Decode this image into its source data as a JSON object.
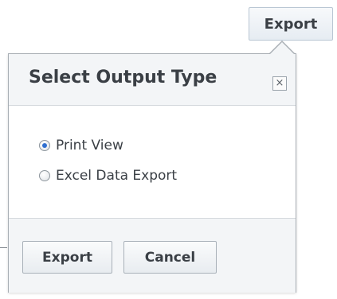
{
  "toolbar": {
    "export_label": "Export"
  },
  "dialog": {
    "title": "Select Output Type",
    "close_glyph": "×",
    "options": [
      {
        "label": "Print View",
        "checked": true
      },
      {
        "label": "Excel Data Export",
        "checked": false
      }
    ],
    "export_label": "Export",
    "cancel_label": "Cancel"
  },
  "colors": {
    "radio_selected": "#2f6fd0",
    "header_bg": "#f3f5f7",
    "border": "#a8aeb4",
    "text": "#3a3f45"
  },
  "icons": {
    "close": "close-icon",
    "radio": "radio-icon"
  }
}
